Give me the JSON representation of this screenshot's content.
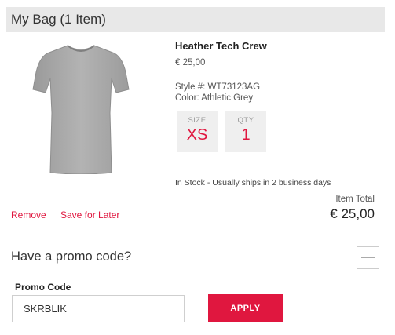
{
  "header": {
    "title": "My Bag (1 Item)"
  },
  "product": {
    "name": "Heather Tech Crew",
    "price": "€ 25,00",
    "style": "Style #: WT73123AG",
    "color": "Color: Athletic Grey",
    "size_label": "SIZE",
    "size_value": "XS",
    "qty_label": "QTY",
    "qty_value": "1",
    "stock": "In Stock - Usually ships in 2 business days",
    "image_color": "#a9a9a9"
  },
  "actions": {
    "remove": "Remove",
    "save_for_later": "Save for Later"
  },
  "total": {
    "label": "Item Total",
    "value": "€ 25,00"
  },
  "promo": {
    "question": "Have a promo code?",
    "label": "Promo Code",
    "code_value": "SKRBLIK",
    "apply": "APPLY"
  },
  "colors": {
    "accent": "#e0173f",
    "header_bg": "#e8e8e8"
  }
}
